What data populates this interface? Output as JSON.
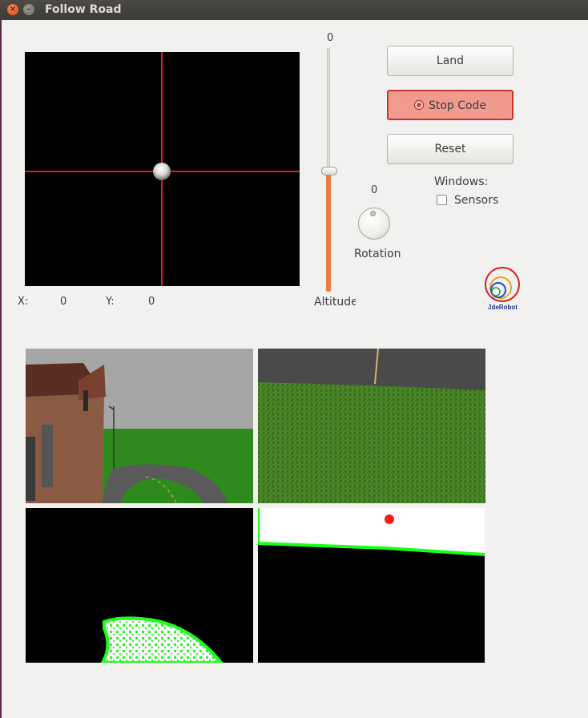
{
  "window": {
    "title": "Follow Road",
    "close_glyph": "×",
    "minimize_glyph": "–"
  },
  "teleop": {
    "x_label": "X:",
    "x_value": "0",
    "y_label": "Y:",
    "y_value": "0"
  },
  "altitude": {
    "value": "0",
    "label": "Altitude",
    "level": 0.5
  },
  "rotation": {
    "value": "0",
    "label": "Rotation"
  },
  "buttons": {
    "land": "Land",
    "stop_code": "Stop Code",
    "reset": "Reset"
  },
  "windows_panel": {
    "label": "Windows:",
    "sensors_label": "Sensors",
    "sensors_checked": false
  },
  "logo": {
    "text": "JdeRobot"
  },
  "colors": {
    "crosshair": "#e01b1b",
    "altitude_slider_fill": "#ee7a3d",
    "stop_button_border": "#c0392b",
    "filter_contour": "#1aff1a",
    "target_dot": "#ff1a1a"
  },
  "icons": [
    "close-icon",
    "minimize-icon",
    "stop-icon",
    "jderobot-logo"
  ]
}
